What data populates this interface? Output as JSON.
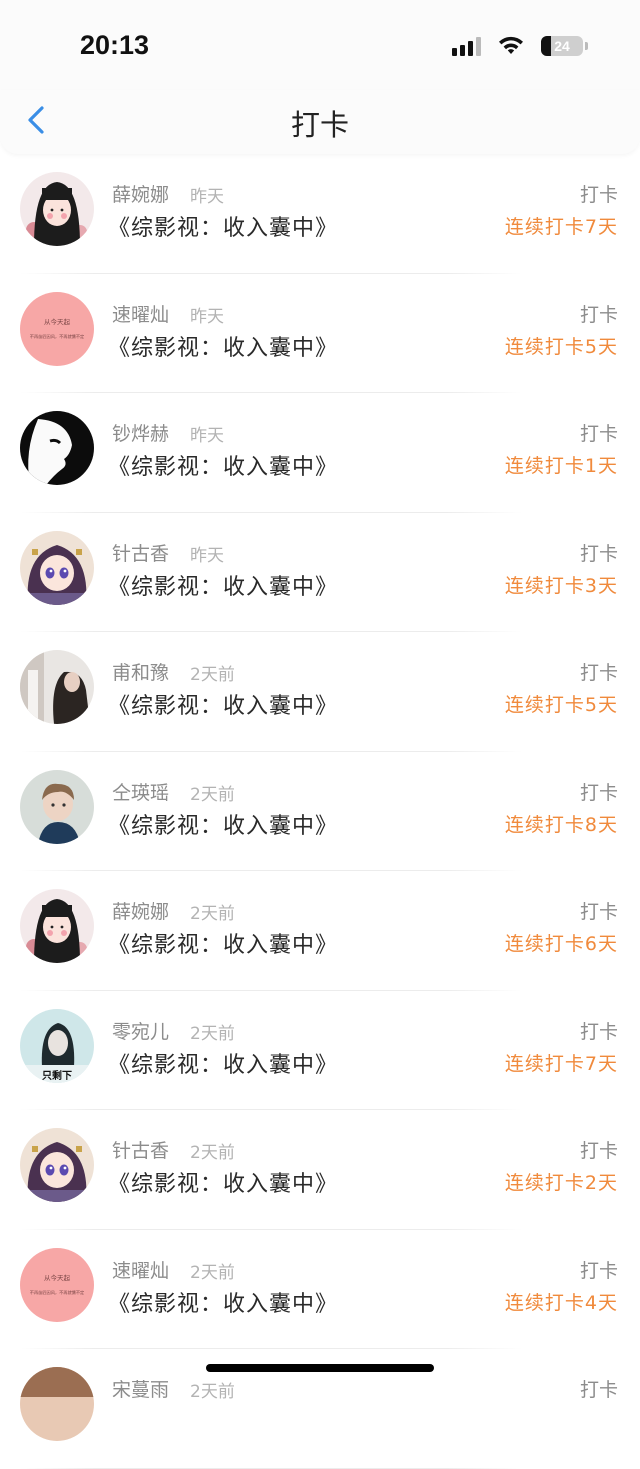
{
  "status": {
    "time": "20:13",
    "battery": "24"
  },
  "nav": {
    "title": "打卡"
  },
  "items": [
    {
      "name": "薛婉娜",
      "time": "昨天",
      "title": "《综影视：收入囊中》",
      "label": "打卡",
      "streak": "连续打卡7天",
      "avatar": "cartoon-girl"
    },
    {
      "name": "速曜灿",
      "time": "昨天",
      "title": "《综影视：收入囊中》",
      "label": "打卡",
      "streak": "连续打卡5天",
      "avatar": "pink-text"
    },
    {
      "name": "钞烨赫",
      "time": "昨天",
      "title": "《综影视：收入囊中》",
      "label": "打卡",
      "streak": "连续打卡1天",
      "avatar": "mask"
    },
    {
      "name": "针古香",
      "time": "昨天",
      "title": "《综影视：收入囊中》",
      "label": "打卡",
      "streak": "连续打卡3天",
      "avatar": "anime"
    },
    {
      "name": "甫和豫",
      "time": "2天前",
      "title": "《综影视：收入囊中》",
      "label": "打卡",
      "streak": "连续打卡5天",
      "avatar": "photo-girl"
    },
    {
      "name": "仝瑛瑶",
      "time": "2天前",
      "title": "《综影视：收入囊中》",
      "label": "打卡",
      "streak": "连续打卡8天",
      "avatar": "child"
    },
    {
      "name": "薛婉娜",
      "time": "2天前",
      "title": "《综影视：收入囊中》",
      "label": "打卡",
      "streak": "连续打卡6天",
      "avatar": "cartoon-girl"
    },
    {
      "name": "零宛儿",
      "time": "2天前",
      "title": "《综影视：收入囊中》",
      "label": "打卡",
      "streak": "连续打卡7天",
      "avatar": "teal-girl"
    },
    {
      "name": "针古香",
      "time": "2天前",
      "title": "《综影视：收入囊中》",
      "label": "打卡",
      "streak": "连续打卡2天",
      "avatar": "anime"
    },
    {
      "name": "速曜灿",
      "time": "2天前",
      "title": "《综影视：收入囊中》",
      "label": "打卡",
      "streak": "连续打卡4天",
      "avatar": "pink-text"
    },
    {
      "name": "宋蔓雨",
      "time": "2天前",
      "title": "",
      "label": "打卡",
      "streak": "",
      "avatar": "partial"
    }
  ],
  "avatar_text": {
    "pink_line1": "从今天起",
    "pink_line2": "不再苗匠因风，不再就慵不定",
    "teal_caption": "只剩下"
  },
  "colors": {
    "accent": "#f08a3c",
    "back": "#3a8ee6"
  }
}
